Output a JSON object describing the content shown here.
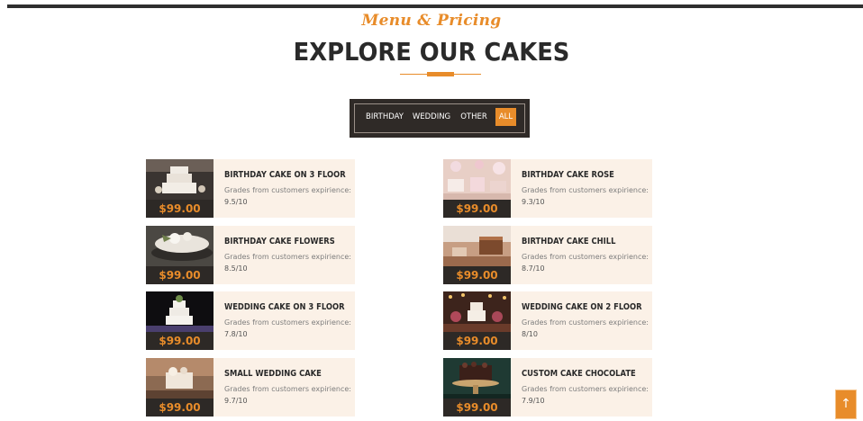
{
  "header": {
    "script_title": "Menu & Pricing",
    "main_title": "EXPLORE OUR CAKES"
  },
  "filters": [
    {
      "label": "BIRTHDAY",
      "active": false
    },
    {
      "label": "WEDDING",
      "active": false
    },
    {
      "label": "OTHER",
      "active": false
    },
    {
      "label": "ALL",
      "active": true
    }
  ],
  "cakes": [
    {
      "title": "BIRTHDAY CAKE ON 3 FLOOR",
      "desc": "Grades from customers expirience:",
      "grade": "9.5/10",
      "price": "$99.00"
    },
    {
      "title": "BIRTHDAY CAKE ROSE",
      "desc": "Grades from customers expirience:",
      "grade": "9.3/10",
      "price": "$99.00"
    },
    {
      "title": "BIRTHDAY CAKE FLOWERS",
      "desc": "Grades from customers expirience:",
      "grade": "8.5/10",
      "price": "$99.00"
    },
    {
      "title": "BIRTHDAY CAKE CHILL",
      "desc": "Grades from customers expirience:",
      "grade": "8.7/10",
      "price": "$99.00"
    },
    {
      "title": "WEDDING CAKE ON 3 FLOOR",
      "desc": "Grades from customers expirience:",
      "grade": "7.8/10",
      "price": "$99.00"
    },
    {
      "title": "WEDDING CAKE ON 2 FLOOR",
      "desc": "Grades from customers expirience:",
      "grade": "8/10",
      "price": "$99.00"
    },
    {
      "title": "SMALL WEDDING CAKE",
      "desc": "Grades from customers expirience:",
      "grade": "9.7/10",
      "price": "$99.00"
    },
    {
      "title": "CUSTOM CAKE CHOCOLATE",
      "desc": "Grades from customers expirience:",
      "grade": "7.9/10",
      "price": "$99.00"
    }
  ],
  "scroll_top": {
    "icon": "arrow-up-icon",
    "glyph": "↑"
  },
  "colors": {
    "accent": "#e88c2a",
    "dark": "#2f2a27",
    "card_bg": "#fbf1e7"
  }
}
